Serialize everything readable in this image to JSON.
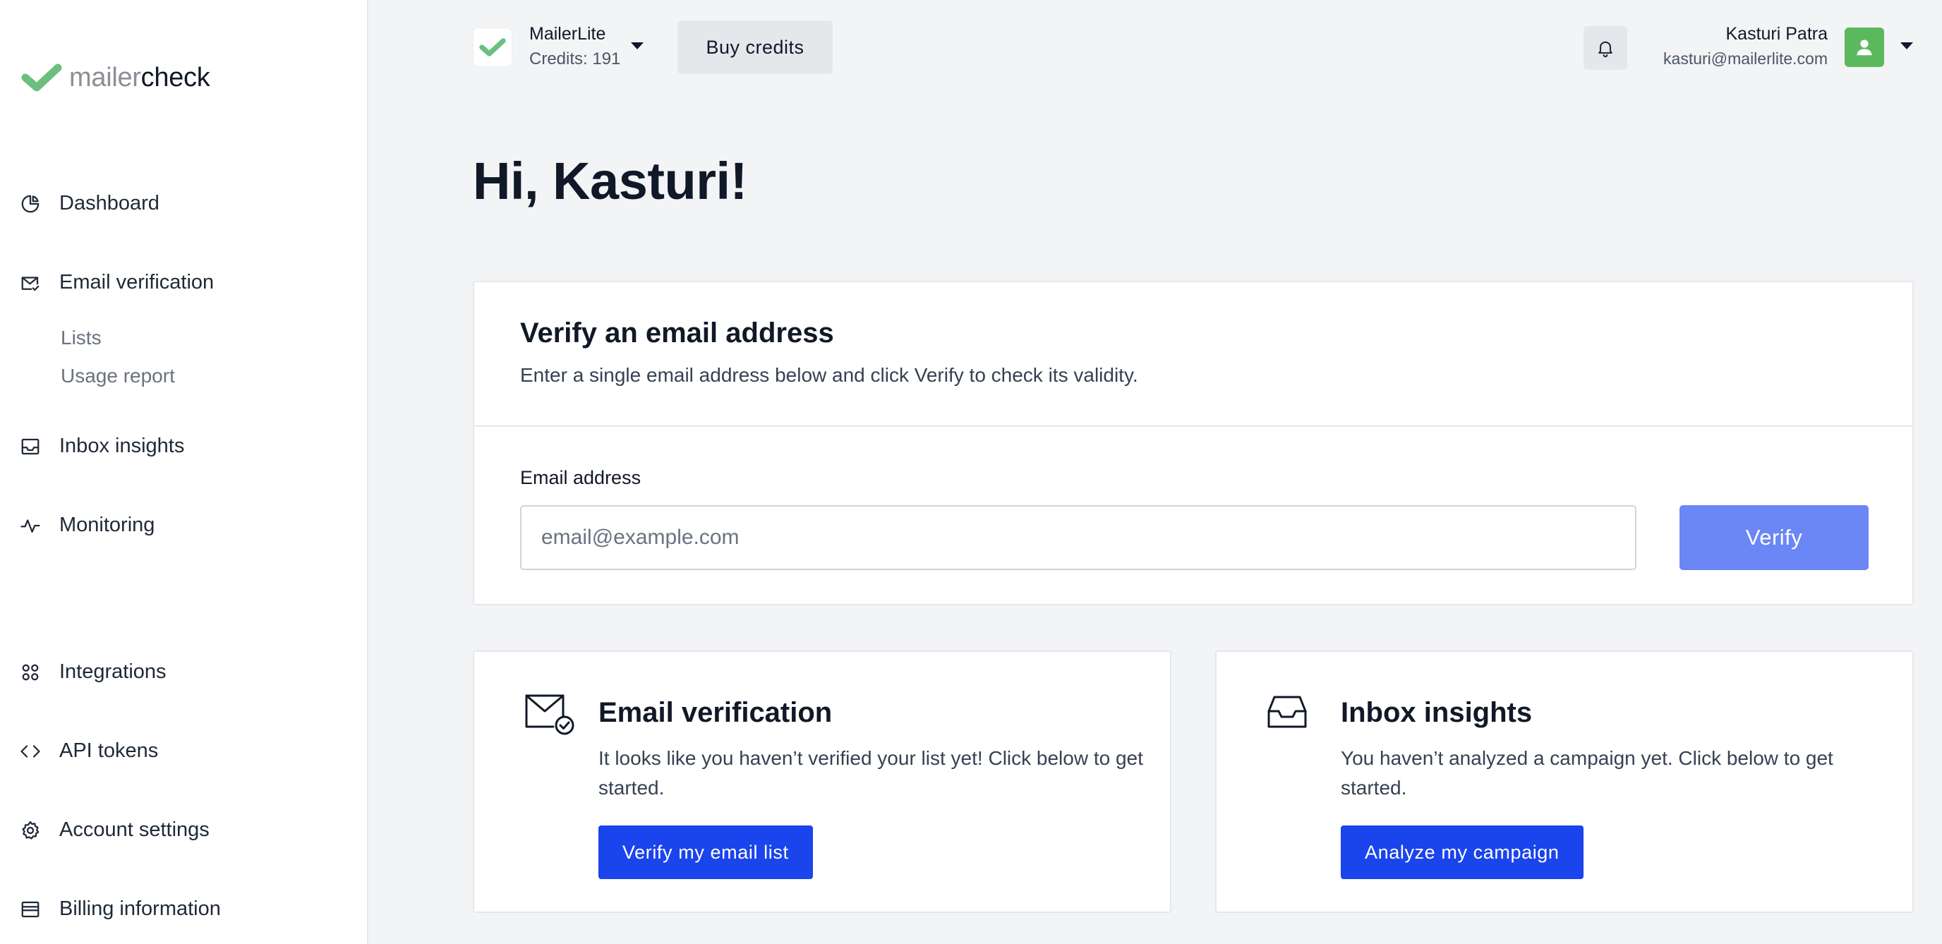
{
  "colors": {
    "brand_green": "#5cb85c",
    "primary_blue": "#1a44ec",
    "verify_button": "#6b86f5",
    "background": "#f3f4f6"
  },
  "logo": {
    "part_light": "mailer",
    "part_dark": "check",
    "icon": "checkmark-logo-icon"
  },
  "sidebar": {
    "items": [
      {
        "label": "Dashboard",
        "icon": "pie-chart-icon"
      },
      {
        "label": "Email verification",
        "icon": "mail-check-icon"
      },
      {
        "label": "Inbox insights",
        "icon": "inbox-icon"
      },
      {
        "label": "Monitoring",
        "icon": "activity-icon"
      },
      {
        "label": "Integrations",
        "icon": "grid-icon"
      },
      {
        "label": "API tokens",
        "icon": "code-icon"
      },
      {
        "label": "Account settings",
        "icon": "gear-icon"
      },
      {
        "label": "Billing information",
        "icon": "card-icon"
      }
    ],
    "subitems": [
      {
        "label": "Lists"
      },
      {
        "label": "Usage report"
      }
    ]
  },
  "header": {
    "account_name": "MailerLite",
    "account_credits": "Credits: 191",
    "buy_credits": "Buy credits",
    "user_name": "Kasturi Patra",
    "user_email": "kasturi@mailerlite.com"
  },
  "greeting": "Hi, Kasturi!",
  "verify_card": {
    "title": "Verify an email address",
    "description": "Enter a single email address below and click Verify to check its validity.",
    "label": "Email address",
    "placeholder": "email@example.com",
    "value": "",
    "button": "Verify"
  },
  "cards": [
    {
      "title": "Email verification",
      "text": "It looks like you haven’t verified your list yet! Click below to get started.",
      "button": "Verify my email list",
      "icon": "mail-check-icon"
    },
    {
      "title": "Inbox insights",
      "text": "You haven’t analyzed a campaign yet. Click below to get started.",
      "button": "Analyze my campaign",
      "icon": "inbox-icon"
    }
  ]
}
